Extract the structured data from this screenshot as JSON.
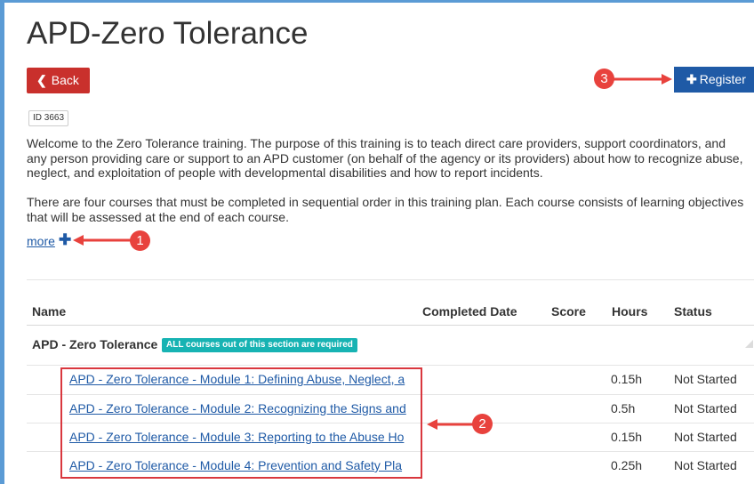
{
  "page": {
    "title": "APD-Zero Tolerance",
    "back_label": "Back",
    "register_label": "Register",
    "id_badge": "ID 3663",
    "description_lines": [
      "Welcome to the Zero Tolerance training. The purpose of this training is to teach direct care providers, support coordinators, and",
      "any person providing care or support to an APD customer (on behalf of the agency or its providers) about how to recognize abuse,",
      "neglect, and exploitation of people with developmental disabilities and how to report incidents."
    ],
    "description2_lines": [
      "There are four courses that must be completed in sequential order in this training plan. Each course consists of learning objectives",
      "that will be assessed at the end of each course."
    ],
    "more_label": "more"
  },
  "table": {
    "headers": {
      "name": "Name",
      "completed_date": "Completed Date",
      "score": "Score",
      "hours": "Hours",
      "status": "Status"
    },
    "section": {
      "title": "APD - Zero Tolerance",
      "badge": "ALL courses out of this section are required"
    },
    "rows": [
      {
        "name": "APD - Zero Tolerance - Module 1: Defining Abuse, Neglect, a",
        "hours": "0.15h",
        "status": "Not Started"
      },
      {
        "name": "APD - Zero Tolerance - Module 2: Recognizing the Signs and",
        "hours": "0.5h",
        "status": "Not Started"
      },
      {
        "name": "APD - Zero Tolerance - Module 3: Reporting to the Abuse Ho",
        "hours": "0.15h",
        "status": "Not Started"
      },
      {
        "name": "APD - Zero Tolerance - Module 4: Prevention and Safety Pla",
        "hours": "0.25h",
        "status": "Not Started"
      }
    ]
  },
  "annotations": {
    "callout_1": "1",
    "callout_2": "2",
    "callout_3": "3",
    "color": "#e8423d"
  },
  "colors": {
    "back_button": "#c9302c",
    "register_button": "#1f5aa6",
    "section_badge": "#17b3b3",
    "link": "#1f5aa6"
  }
}
